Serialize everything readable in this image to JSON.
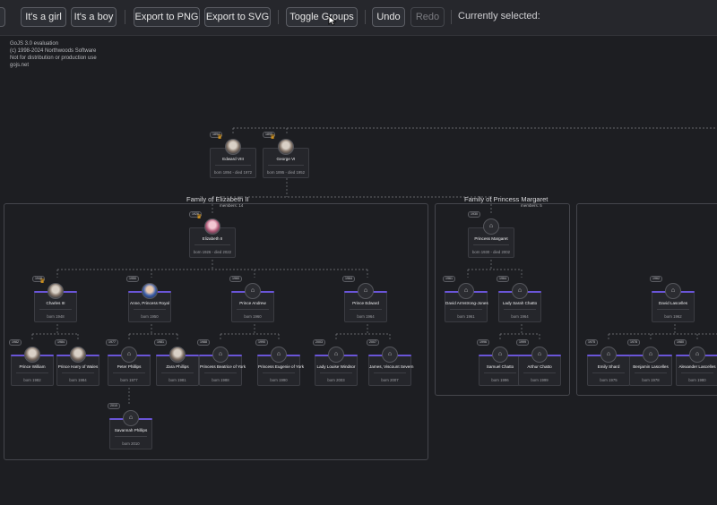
{
  "toolbar": {
    "buttons": [
      {
        "name": "its-a-girl-button",
        "label": "It's a girl",
        "disabled": false
      },
      {
        "name": "its-a-boy-button",
        "label": "It's a boy",
        "disabled": false
      },
      {
        "name": "export-png-button",
        "label": "Export to PNG",
        "disabled": false
      },
      {
        "name": "export-svg-button",
        "label": "Export to SVG",
        "disabled": false
      },
      {
        "name": "toggle-groups-button",
        "label": "Toggle Groups",
        "disabled": false
      },
      {
        "name": "undo-button",
        "label": "Undo",
        "disabled": false
      },
      {
        "name": "redo-button",
        "label": "Redo",
        "disabled": true
      }
    ],
    "selected_label": "Currently selected:"
  },
  "watermark": [
    "GoJS 3.0 evaluation",
    "(c) 1998-2024 Northwoods Software",
    "Not for distribution or production use",
    "gojs.net"
  ],
  "groups": [
    {
      "name": "group-elizabeth",
      "title": "Family of Elizabeth II",
      "count": "members: 14"
    },
    {
      "name": "group-margaret",
      "title": "Family of Princess Margaret",
      "count": "members: 5"
    }
  ],
  "people": [
    {
      "name": "Edward VIII",
      "dates": "born 1894 - died 1972",
      "year": "1894",
      "avatar": "photo",
      "crown": true
    },
    {
      "name": "George VI",
      "dates": "born 1895 - died 1952",
      "year": "1895",
      "avatar": "photo",
      "crown": true
    },
    {
      "name": "Elizabeth II",
      "dates": "born 1926 - died 2022",
      "year": "1926",
      "avatar": "queen",
      "crown": true
    },
    {
      "name": "Princess Margaret",
      "dates": "born 1930 - died 2002",
      "year": "1930",
      "avatar": "icon",
      "crown": false
    },
    {
      "name": "Charles III",
      "dates": "born 1948",
      "year": "1948",
      "avatar": "photo",
      "crown": true
    },
    {
      "name": "Anne, Princess Royal",
      "dates": "born 1950",
      "year": "1950",
      "avatar": "blue",
      "crown": false
    },
    {
      "name": "Prince Andrew",
      "dates": "born 1960",
      "year": "1960",
      "avatar": "icon",
      "crown": false
    },
    {
      "name": "Prince Edward",
      "dates": "born 1964",
      "year": "1964",
      "avatar": "icon",
      "crown": false
    },
    {
      "name": "David Armstrong-Jones",
      "dates": "born 1961",
      "year": "1961",
      "avatar": "icon",
      "crown": false
    },
    {
      "name": "Lady Sarah Chatto",
      "dates": "born 1964",
      "year": "1964",
      "avatar": "icon",
      "crown": false
    },
    {
      "name": "David Lascelles",
      "dates": "born 1962",
      "year": "1962",
      "avatar": "icon",
      "crown": false
    },
    {
      "name": "Prince William",
      "dates": "born 1982",
      "year": "1982",
      "avatar": "photo",
      "crown": false
    },
    {
      "name": "Prince Harry of Wales",
      "dates": "born 1984",
      "year": "1984",
      "avatar": "photo",
      "crown": false
    },
    {
      "name": "Peter Phillips",
      "dates": "born 1977",
      "year": "1977",
      "avatar": "icon",
      "crown": false
    },
    {
      "name": "Zara Phillips",
      "dates": "born 1981",
      "year": "1981",
      "avatar": "photo",
      "crown": false
    },
    {
      "name": "Princess Beatrice of York",
      "dates": "born 1988",
      "year": "1988",
      "avatar": "icon",
      "crown": false
    },
    {
      "name": "Princess Eugenie of York",
      "dates": "born 1990",
      "year": "1990",
      "avatar": "icon",
      "crown": false
    },
    {
      "name": "Lady Louise Windsor",
      "dates": "born 2003",
      "year": "2003",
      "avatar": "icon",
      "crown": false
    },
    {
      "name": "James, Viscount Severn",
      "dates": "born 2007",
      "year": "2007",
      "avatar": "icon",
      "crown": false
    },
    {
      "name": "Samuel Chatto",
      "dates": "born 1996",
      "year": "1996",
      "avatar": "icon",
      "crown": false
    },
    {
      "name": "Arthur Chatto",
      "dates": "born 1999",
      "year": "1999",
      "avatar": "icon",
      "crown": false
    },
    {
      "name": "Emily Shard",
      "dates": "born 1975",
      "year": "1975",
      "avatar": "icon",
      "crown": false
    },
    {
      "name": "Benjamin Lascelles",
      "dates": "born 1978",
      "year": "1978",
      "avatar": "icon",
      "crown": false
    },
    {
      "name": "Alexander Lascelles",
      "dates": "born 1980",
      "year": "1980",
      "avatar": "icon",
      "crown": false
    },
    {
      "name": "Savannah Phillips",
      "dates": "born 2010",
      "year": "2010",
      "avatar": "icon",
      "crown": false
    }
  ],
  "colors": {
    "accent": "#6a55d8",
    "crown": "#f2a516",
    "background": "#1d1e22",
    "card": "#25262b"
  }
}
